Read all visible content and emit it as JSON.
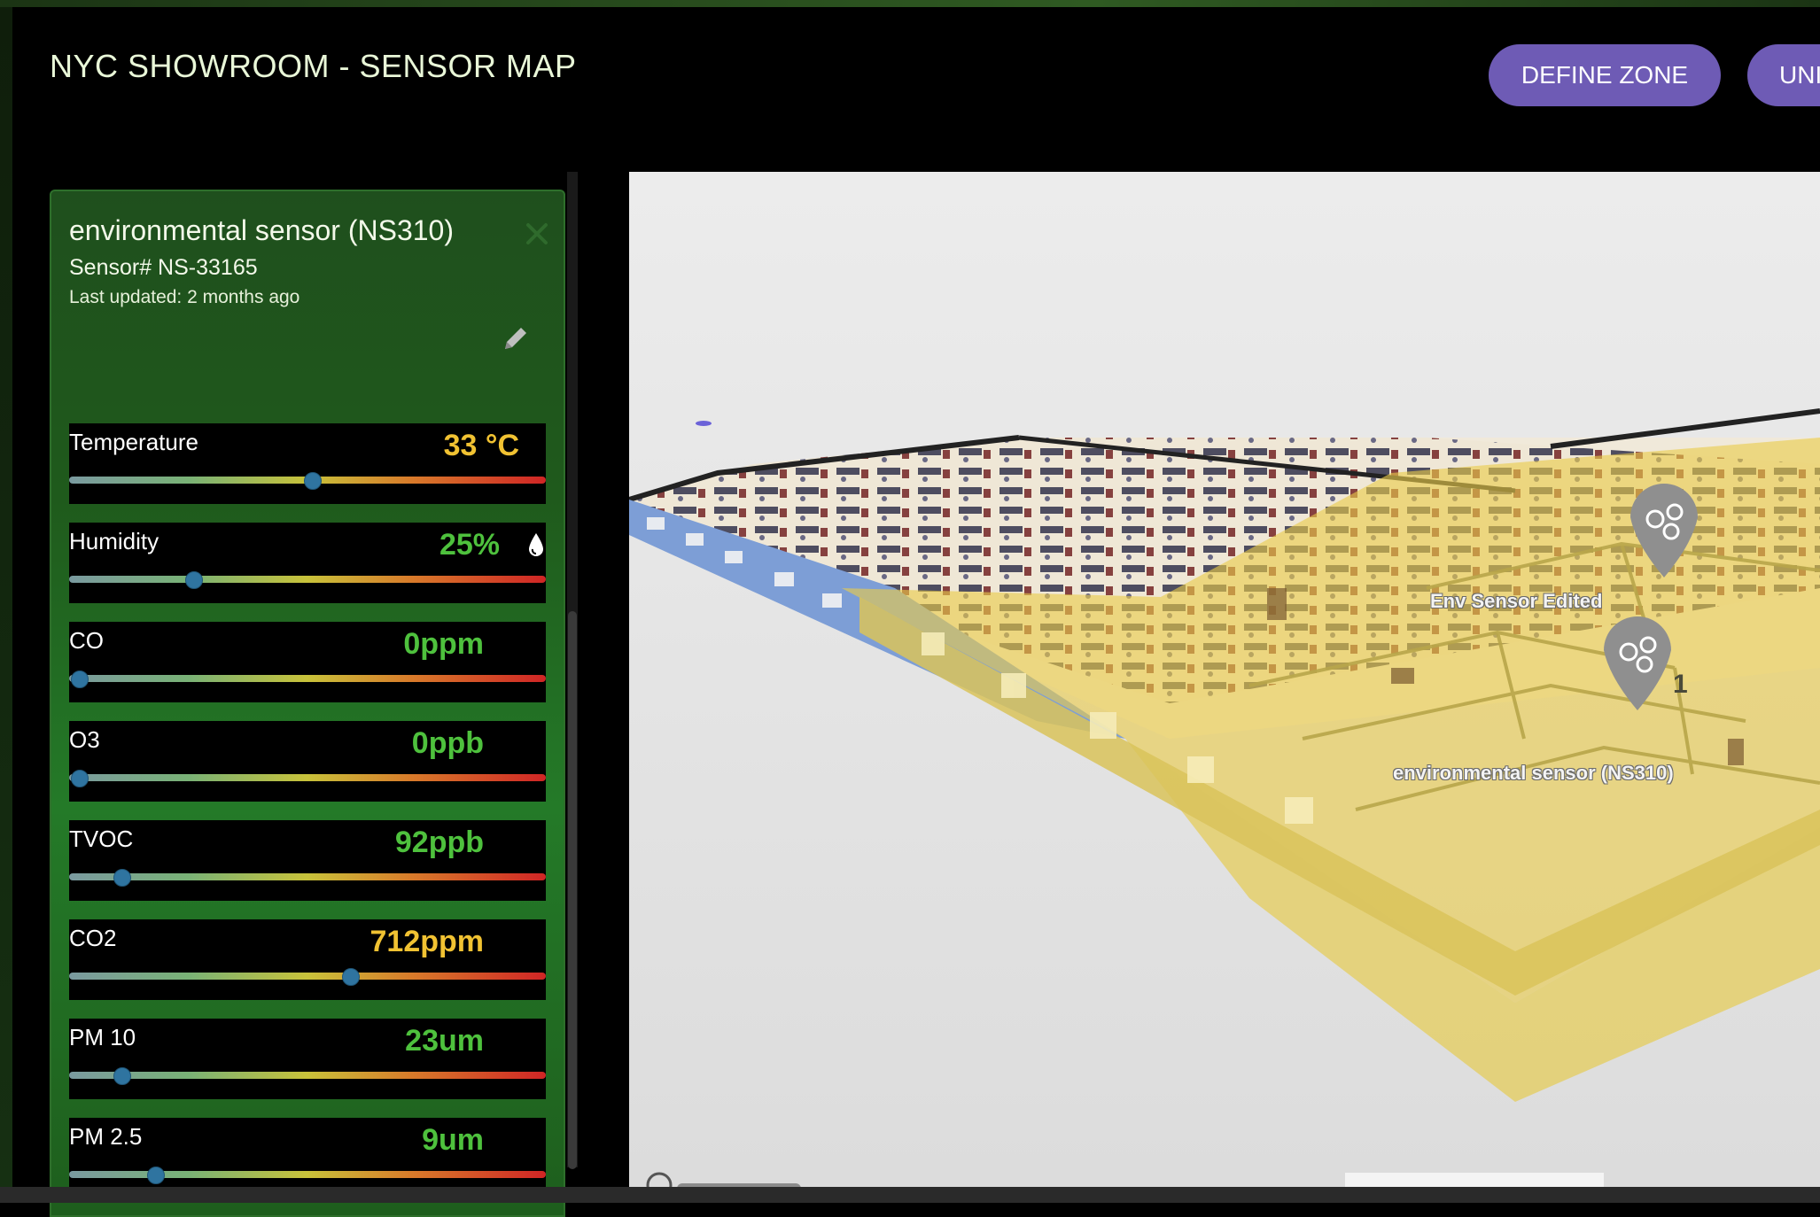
{
  "header": {
    "title": "NYC SHOWROOM - SENSOR MAP",
    "buttons": [
      "DEFINE ZONE",
      "UNI"
    ]
  },
  "panel": {
    "title": "environmental sensor (NS310)",
    "sensor_id": "Sensor# NS-33165",
    "last_updated": "Last updated: 2 months ago",
    "metrics": [
      {
        "label": "Temperature",
        "value": "33 °C",
        "status": "warning",
        "level_percent": 51
      },
      {
        "label": "Humidity",
        "value": "25%",
        "status": "ok",
        "level_percent": 26
      },
      {
        "label": "CO",
        "value": "0ppm",
        "status": "ok",
        "level_percent": 2
      },
      {
        "label": "O3",
        "value": "0ppb",
        "status": "ok",
        "level_percent": 2
      },
      {
        "label": "TVOC",
        "value": "92ppb",
        "status": "ok",
        "level_percent": 11
      },
      {
        "label": "CO2",
        "value": "712ppm",
        "status": "warning",
        "level_percent": 59
      },
      {
        "label": "PM 10",
        "value": "23um",
        "status": "ok",
        "level_percent": 11
      },
      {
        "label": "PM 2.5",
        "value": "9um",
        "status": "ok",
        "level_percent": 18
      }
    ]
  },
  "map": {
    "markers": [
      {
        "label": "Env Sensor Edited",
        "icon": "leaf-sensor-icon"
      },
      {
        "label": "environmental sensor (NS310)",
        "icon": "leaf-sensor-icon"
      }
    ],
    "zone_number": "1"
  },
  "colors": {
    "accent_button": "#6e5bb5",
    "panel_green": "#1f5a1c",
    "warning": "#f1c232",
    "ok": "#4ec13d",
    "zone_yellow": "#eacb4a"
  }
}
